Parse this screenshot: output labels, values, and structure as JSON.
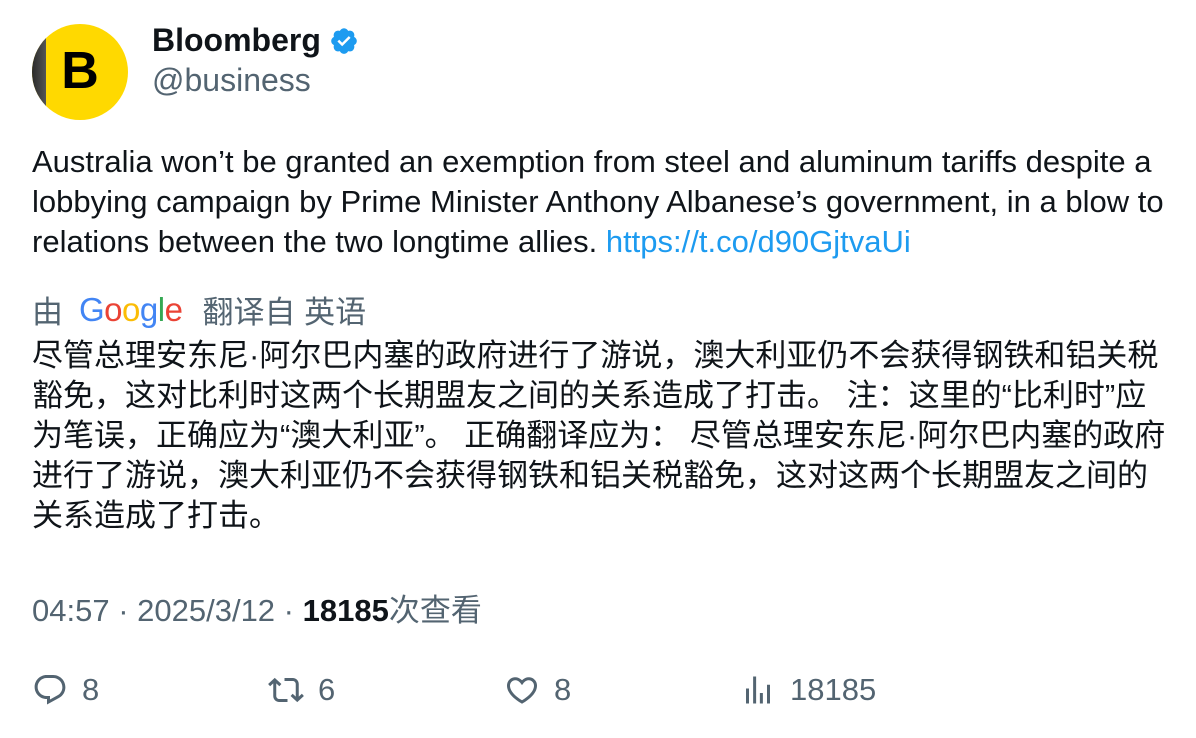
{
  "author": {
    "avatar_letter": "B",
    "display_name": "Bloomberg",
    "handle": "@business",
    "verified": true,
    "colors": {
      "avatar_bg": "#ffd900",
      "verified": "#1d9bf0"
    }
  },
  "tweet": {
    "text": "Australia won’t be granted an exemption from steel and aluminum tariffs despite a lobbying campaign by Prime Minister Anthony Albanese’s government, in a blow to relations between the two longtime allies. ",
    "link": "https://t.co/d90GjtvaUi"
  },
  "translation": {
    "prefix": "由",
    "provider": "Google",
    "suffix": "翻译自 英语",
    "text": "尽管总理安东尼·阿尔巴内塞的政府进行了游说，澳大利亚仍不会获得钢铁和铝关税豁免，这对比利时这两个长期盟友之间的关系造成了打击。 注：这里的“比利时”应为笔误，正确应为“澳大利亚”。 正确翻译应为： 尽管总理安东尼·阿尔巴内塞的政府进行了游说，澳大利亚仍不会获得钢铁和铝关税豁免，这对这两个长期盟友之间的关系造成了打击。"
  },
  "meta": {
    "time": "04:57",
    "separator": " · ",
    "date": "2025/3/12",
    "views_count": "18185",
    "views_label": "次查看"
  },
  "actions": {
    "replies": "8",
    "retweets": "6",
    "likes": "8",
    "views": "18185",
    "icons": [
      "reply-icon",
      "retweet-icon",
      "like-icon",
      "views-icon"
    ]
  }
}
